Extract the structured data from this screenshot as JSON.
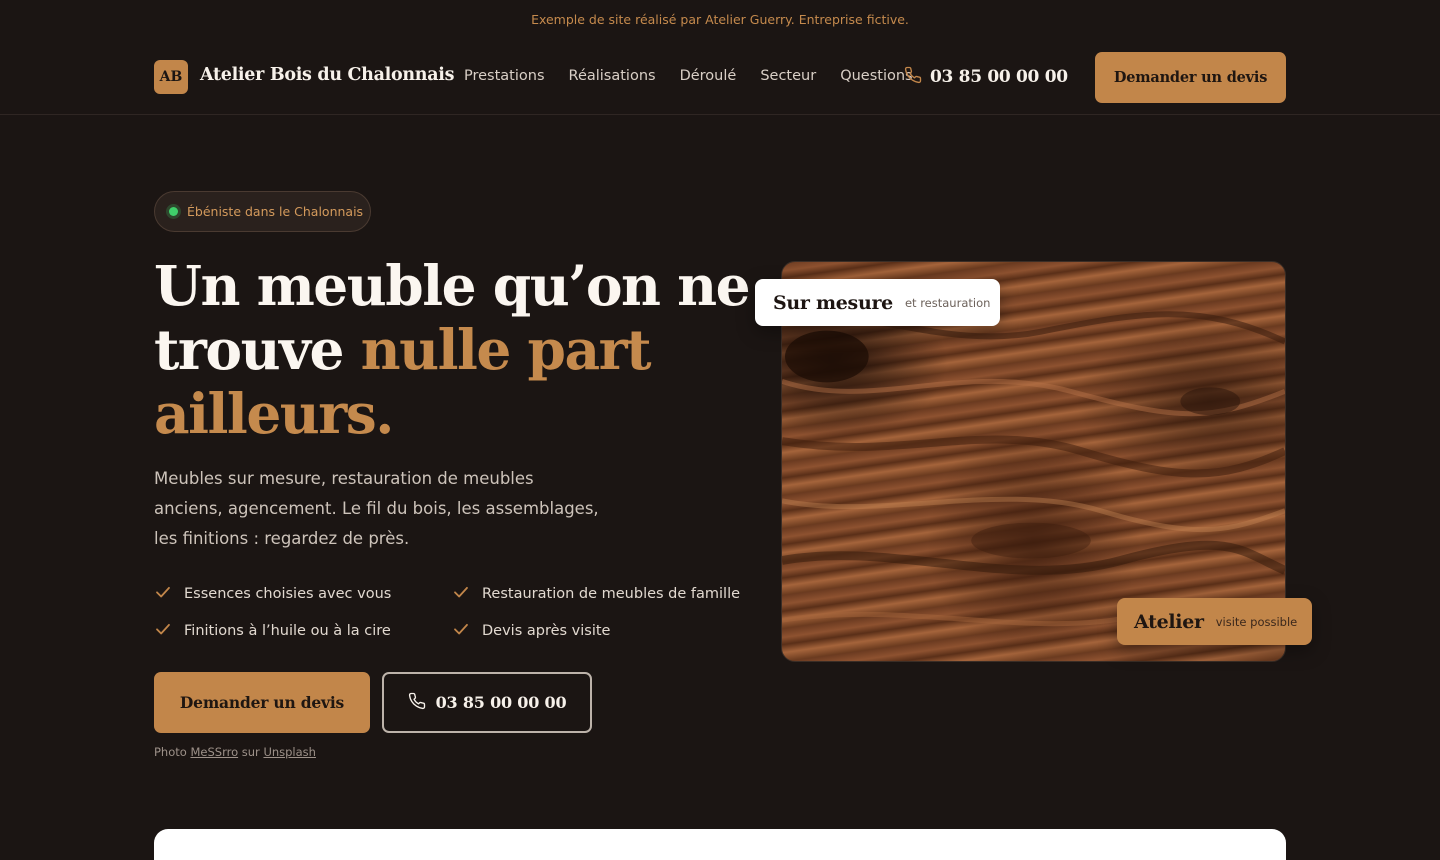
{
  "notice": "Exemple de site réalisé par Atelier Guerry. Entreprise fictive.",
  "header": {
    "logo_initials": "AB",
    "brand": "Atelier Bois du Chalonnais",
    "nav": [
      "Prestations",
      "Réalisations",
      "Déroulé",
      "Secteur",
      "Questions"
    ],
    "phone": "03 85 00 00 00",
    "cta": "Demander un devis"
  },
  "hero": {
    "badge": "Ébéniste dans le Chalonnais",
    "title_part1": "Un meuble qu’on ne trouve ",
    "title_accent": "nulle part ailleurs.",
    "lead": "Meubles sur mesure, restauration de meubles anciens, agencement. Le fil du bois, les assemblages, les finitions : regardez de près.",
    "features": [
      "Essences choisies avec vous",
      "Restauration de meubles de famille",
      "Finitions à l’huile ou à la cire",
      "Devis après visite"
    ],
    "cta": "Demander un devis",
    "phone": "03 85 00 00 00",
    "credit_prefix": "Photo",
    "credit_author": "MeSSrro",
    "credit_mid": "sur",
    "credit_site": "Unsplash",
    "tag_top_big": "Sur mesure",
    "tag_top_small": "et restauration",
    "tag_bottom_big": "Atelier",
    "tag_bottom_small": "visite possible"
  },
  "colors": {
    "background": "#1b1513",
    "accent": "#c2864a",
    "status_dot": "#3fcf6a"
  },
  "icons": [
    "phone-icon",
    "check-icon",
    "status-dot"
  ]
}
